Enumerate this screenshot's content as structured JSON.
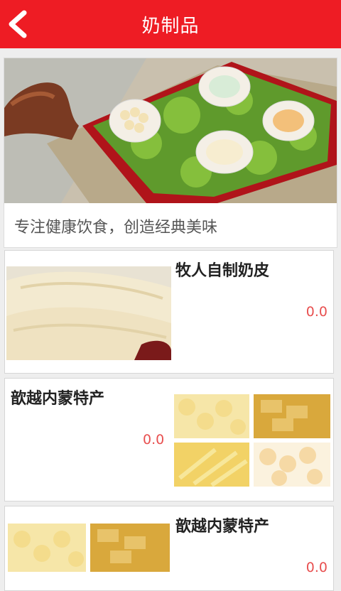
{
  "header": {
    "title": "奶制品",
    "back_icon": "back-arrow-icon"
  },
  "banner": {
    "tagline": "专注健康饮食，创造经典美味"
  },
  "products": [
    {
      "name": "牧人自制奶皮",
      "price": "0.0"
    },
    {
      "name": "歆越内蒙特产",
      "price": "0.0"
    },
    {
      "name": "歆越内蒙特产",
      "price": "0.0"
    }
  ],
  "colors": {
    "header_bg": "#ee1c24",
    "price": "#e85050"
  }
}
